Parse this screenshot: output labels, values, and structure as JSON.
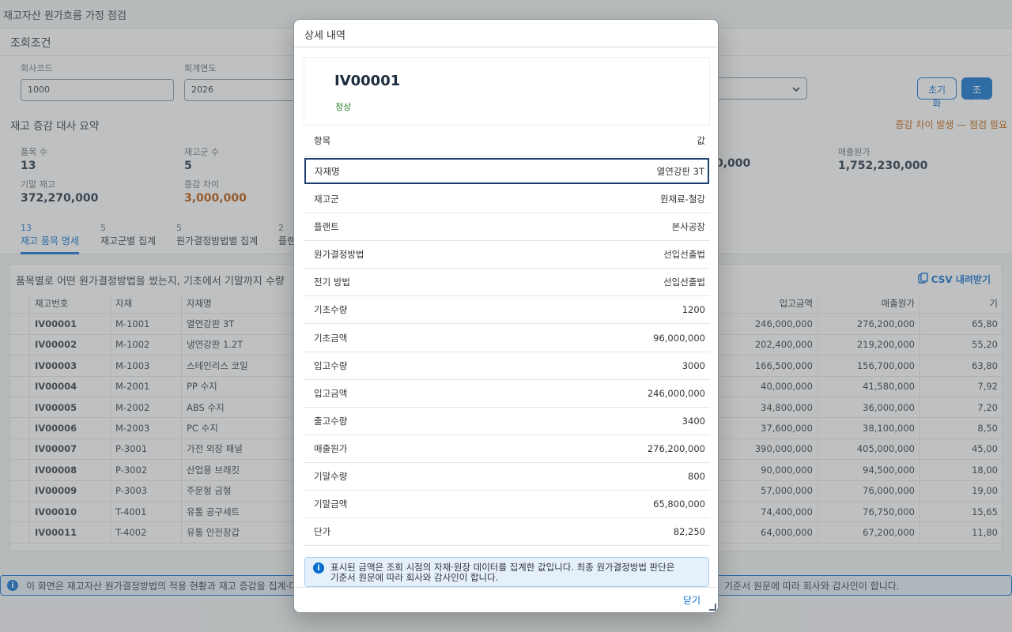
{
  "page": {
    "title": "재고자산 원가흐름 가정 점검"
  },
  "filter": {
    "title": "조회조건",
    "company_label": "회사코드",
    "company_value": "1000",
    "year_label": "회계연도",
    "year_value": "2026",
    "reset_label": "초기화",
    "go_label": "조회"
  },
  "summary": {
    "title": "재고 증감 대사 요약",
    "warning": "증감 차이 발생 — 점검 필요",
    "kpis": [
      {
        "label": "품목 수",
        "value": "13"
      },
      {
        "label": "재고군 수",
        "value": "5"
      },
      {
        "label": "기말 재고",
        "value": "372,270,000"
      },
      {
        "label": "증감 차이",
        "value": "3,000,000"
      },
      {
        "label": "",
        "value": "0,000"
      },
      {
        "label": "매출원가",
        "value": "1,752,230,000"
      }
    ]
  },
  "tabs": [
    {
      "count": "13",
      "label": "재고 품목 명세"
    },
    {
      "count": "5",
      "label": "재고군별 집계"
    },
    {
      "count": "5",
      "label": "원가결정방법별 집계"
    },
    {
      "count": "2",
      "label": "플랜"
    }
  ],
  "table": {
    "title": "품목별로 어떤 원가결정방법을 썼는지, 기초에서 기말까지 수량",
    "csv_label": "CSV 내려받기",
    "headers": [
      "재고번호",
      "자재",
      "자재명",
      "입고금액",
      "매출원가",
      "기"
    ],
    "rows": [
      [
        "IV00001",
        "M-1001",
        "열연강판 3T",
        "246,000,000",
        "276,200,000",
        "65,80"
      ],
      [
        "IV00002",
        "M-1002",
        "냉연강판 1.2T",
        "202,400,000",
        "219,200,000",
        "55,20"
      ],
      [
        "IV00003",
        "M-1003",
        "스테인리스 코일",
        "166,500,000",
        "156,700,000",
        "63,80"
      ],
      [
        "IV00004",
        "M-2001",
        "PP 수지",
        "40,000,000",
        "41,580,000",
        "7,92"
      ],
      [
        "IV00005",
        "M-2002",
        "ABS 수지",
        "34,800,000",
        "36,000,000",
        "7,20"
      ],
      [
        "IV00006",
        "M-2003",
        "PC 수지",
        "37,600,000",
        "38,100,000",
        "8,50"
      ],
      [
        "IV00007",
        "P-3001",
        "가전 외장 패널",
        "390,000,000",
        "405,000,000",
        "45,00"
      ],
      [
        "IV00008",
        "P-3002",
        "산업용 브래킷",
        "90,000,000",
        "94,500,000",
        "18,00"
      ],
      [
        "IV00009",
        "P-3003",
        "주문형 금형",
        "57,000,000",
        "76,000,000",
        "19,00"
      ],
      [
        "IV00010",
        "T-4001",
        "유통 공구세트",
        "74,400,000",
        "76,750,000",
        "15,65"
      ],
      [
        "IV00011",
        "T-4002",
        "유통 안전장갑",
        "64,000,000",
        "67,200,000",
        "11,80"
      ]
    ]
  },
  "bg_info": {
    "left": "이 화면은 재고자산 원가결정방법의 적용 현황과 재고 증감을 집계·대",
    "right": "기준서 원문에 따라 회사와 감사인이 합니다."
  },
  "dialog": {
    "title": "상세 내역",
    "object_id": "IV00001",
    "status": "정상",
    "col_item": "항목",
    "col_value": "값",
    "rows": [
      {
        "k": "자재명",
        "v": "열연강판 3T"
      },
      {
        "k": "재고군",
        "v": "원재료-철강"
      },
      {
        "k": "플랜트",
        "v": "본사공장"
      },
      {
        "k": "원가결정방법",
        "v": "선입선출법"
      },
      {
        "k": "전기 방법",
        "v": "선입선출법"
      },
      {
        "k": "기초수량",
        "v": "1200"
      },
      {
        "k": "기초금액",
        "v": "96,000,000"
      },
      {
        "k": "입고수량",
        "v": "3000"
      },
      {
        "k": "입고금액",
        "v": "246,000,000"
      },
      {
        "k": "출고수량",
        "v": "3400"
      },
      {
        "k": "매출원가",
        "v": "276,200,000"
      },
      {
        "k": "기말수량",
        "v": "800"
      },
      {
        "k": "기말금액",
        "v": "65,800,000"
      },
      {
        "k": "단가",
        "v": "82,250"
      }
    ],
    "info_line1": "표시된 금액은 조회 시점의 자재·원장 데이터를 집계한 값입니다. 최종 원가결정방법 판단은",
    "info_line2": "기준서 원문에 따라 회사와 감사인이 합니다.",
    "close_label": "닫기"
  }
}
